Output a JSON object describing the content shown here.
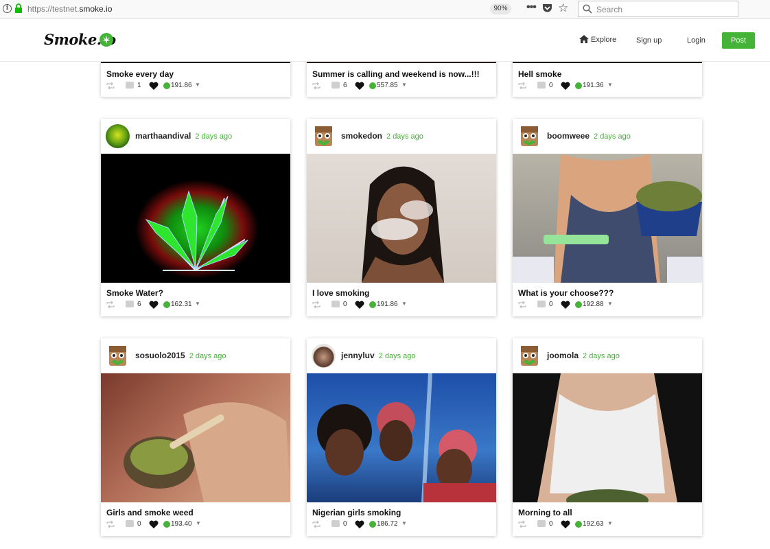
{
  "browser": {
    "url_prefix": "https://testnet.",
    "url_domain": "smoke.io",
    "zoom": "90%",
    "search_placeholder": "Search"
  },
  "header": {
    "logo": "Smoke.io",
    "nav": {
      "explore": "Explore",
      "signup": "Sign up",
      "login": "Login"
    },
    "post_button": "Post",
    "accent_color": "#45b337"
  },
  "posts": [
    {
      "author": "",
      "time": "",
      "title": "Smoke every day",
      "comments": "1",
      "payout": "191.86"
    },
    {
      "author": "",
      "time": "",
      "title": "Summer is calling and weekend is now...!!!",
      "comments": "6",
      "payout": "557.85"
    },
    {
      "author": "",
      "time": "",
      "title": "Hell smoke",
      "comments": "0",
      "payout": "191.36"
    },
    {
      "author": "marthaandival",
      "time": "2 days ago",
      "title": "Smoke Water?",
      "comments": "6",
      "payout": "162.31"
    },
    {
      "author": "smokedon",
      "time": "2 days ago",
      "title": "I love smoking",
      "comments": "0",
      "payout": "191.86"
    },
    {
      "author": "boomweee",
      "time": "2 days ago",
      "title": "What is your choose???",
      "comments": "0",
      "payout": "192.88"
    },
    {
      "author": "sosuolo2015",
      "time": "2 days ago",
      "title": "Girls and smoke weed",
      "comments": "0",
      "payout": "193.40"
    },
    {
      "author": "jennyluv",
      "time": "2 days ago",
      "title": "Nigerian girls smoking",
      "comments": "0",
      "payout": "186.72"
    },
    {
      "author": "joomola",
      "time": "2 days ago",
      "title": "Morning to all",
      "comments": "0",
      "payout": "192.63"
    }
  ]
}
